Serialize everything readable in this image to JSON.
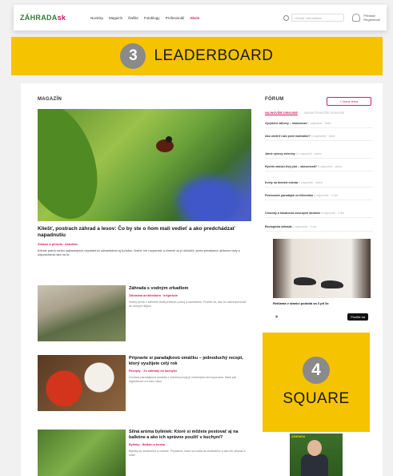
{
  "header": {
    "logo": "ZÁHRADA",
    "logo_suffix": "sk",
    "nav": [
      "Novinky",
      "Magazín",
      "Ďalšie",
      "Fotoblogy",
      "Profesionáli",
      "Akcie"
    ],
    "search_placeholder": "Hľadať záhradkára",
    "account": [
      "Prihlásiť",
      "Registrovať"
    ]
  },
  "placements": {
    "leaderboard": {
      "number": "3",
      "label": "LEADERBOARD"
    },
    "square": {
      "number": "4",
      "label": "SQUARE"
    }
  },
  "colors": {
    "placement": "#f5c300",
    "accent": "#d81b60",
    "brand": "#2e7d32"
  },
  "magazine": {
    "section_title": "MAGAZÍN",
    "hero": {
      "title": "Kliešť, postrach záhrad a lesov: Čo by ste o ňom mali vedieť a ako predchádzať napadnutiu",
      "meta": "Zdravie a príroda · Aktuálne",
      "excerpt": "Kliešte patria medzi najčastejších nepriateľov záhradkárov aj turistov. Vedieť ich rozpoznať a chrániť sa je dôležité, preto prinášame užitočné rady a odporúčania, ako na to."
    },
    "articles": [
      {
        "title": "Záhrada s vodným zrkadlom",
        "meta": "Záhradná architektúra · Inšpirácie",
        "excerpt": "Vodný prvok v záhrade dodá priestoru pokoj a osvieženie. Pozrite sa, ako ho zakomponovať do rôznych štýlov."
      },
      {
        "title": "Pripravte si paradajkovú omáčku – jednoduchý recept, ktorý využijete celý rok",
        "meta": "Recepty · Zo záhrady do kuchyne",
        "excerpt": "Domáca paradajková omáčka z vlastnej úrody je chutnejšia než kupovaná. Stačí pár ingrediencií a trochu času."
      },
      {
        "title": "Silná aróma byliniek: Ktoré si môžete pestovať aj na balkóne a ako ich správne použiť v kuchyni?",
        "meta": "Bylinky · Balkón a terasa",
        "excerpt": "Bylinky sú nenáročné a voňavé. Poradíme, ktoré sa hodia do kvetináčov a ako ich zbierať a sušiť."
      }
    ]
  },
  "sidebar": {
    "forum_title": "FÓRUM",
    "forum_button": "+ Nová téma",
    "tabs": [
      "NAJNOVŠIE DISKUSIE",
      "NAJAKTÍVNEJŠIE DISKUSIE"
    ],
    "threads": [
      {
        "title": "Vyvýšené záhony – skúsenosti",
        "info": "7 odpovedí · dnes"
      },
      {
        "title": "Ako ošetriť ruže proti múčnatke?",
        "info": "3 odpovede · dnes"
      },
      {
        "title": "Jarné výsevy zeleniny",
        "info": "12 odpovedí · včera"
      },
      {
        "title": "Rýchlo rastúci živý plot – skúsenosti?",
        "info": "5 odpovedí · včera"
      },
      {
        "title": "Kvety na tienisté miesta",
        "info": "9 odpovedí · včera"
      },
      {
        "title": "Pestovanie paradajok vo fóliovníku",
        "info": "4 odpovede · 2 dni"
      },
      {
        "title": "Choroby a škodcovia ovocných stromov",
        "info": "6 odpovedí · 2 dni"
      },
      {
        "title": "Ekologická záhrada",
        "info": "2 odpovede · 3 dni"
      }
    ],
    "ad_caption": "Reklama v stanici podobá sa 3 plt 3x",
    "ad_cta": "Pozrite sa",
    "ad_bottom_label": "ZÁHRADA"
  }
}
